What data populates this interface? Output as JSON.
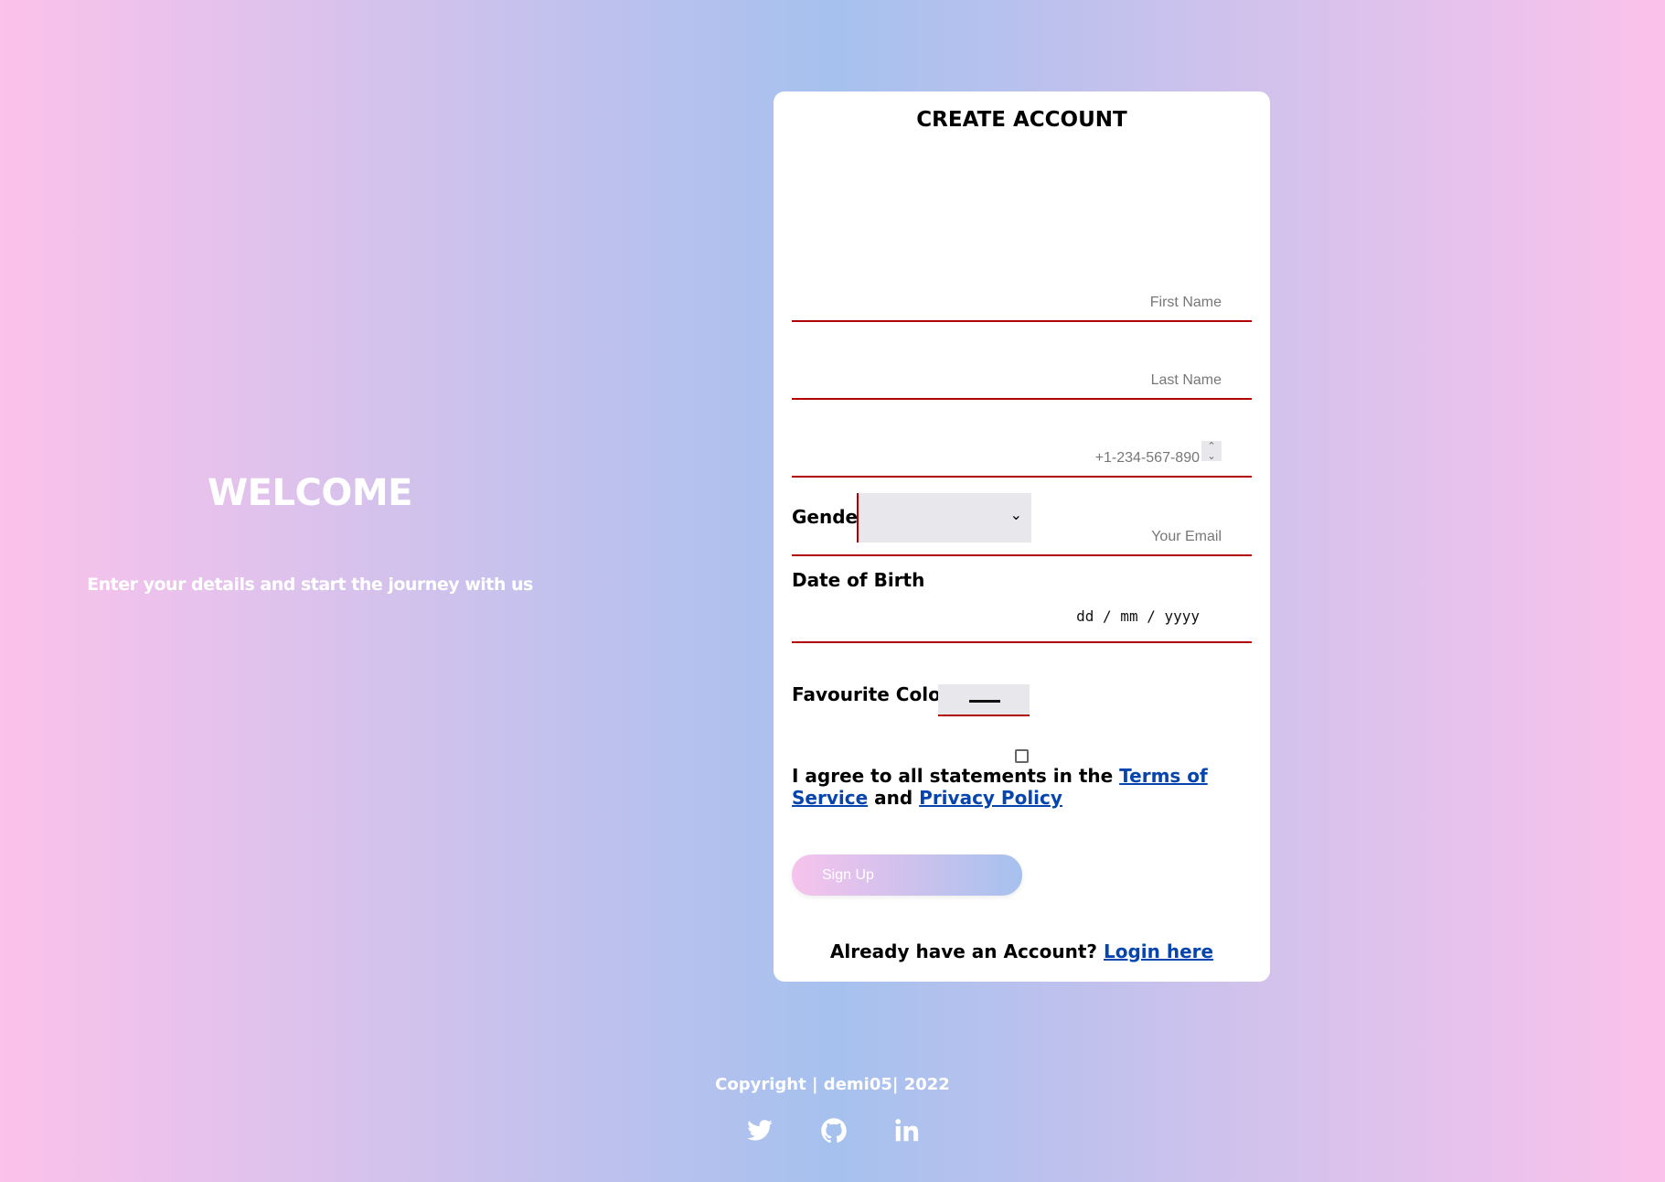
{
  "welcome": {
    "title": "WELCOME",
    "subtitle": "Enter your details and start the journey with us"
  },
  "form": {
    "title": "CREATE ACCOUNT",
    "first_name_placeholder": "First Name",
    "last_name_placeholder": "Last Name",
    "phone_placeholder": "+1-234-567-890",
    "email_placeholder": "Your Email",
    "gender_label": "Gender",
    "gender_selected": "",
    "dob_label": "Date of Birth",
    "dob_placeholder": "dd / mm / yyyy",
    "color_label": "Favourite Color",
    "color_value": "#000000",
    "agree_text": "I agree to all statements in the",
    "terms_link": "Terms of Service",
    "and_text": "and",
    "privacy_link": "Privacy Policy",
    "signup_label": "Sign Up",
    "login_prompt": "Already have an Account?",
    "login_link": "Login here"
  },
  "footer": {
    "copyright": "Copyright | demi05| 2022",
    "social": [
      "twitter-icon",
      "github-icon",
      "linkedin-icon"
    ]
  },
  "colors": {
    "accent_red": "#b00000",
    "link_blue": "#0645ad",
    "gradient_pink": "#fbc2eb",
    "gradient_blue": "#a6c1ee"
  }
}
